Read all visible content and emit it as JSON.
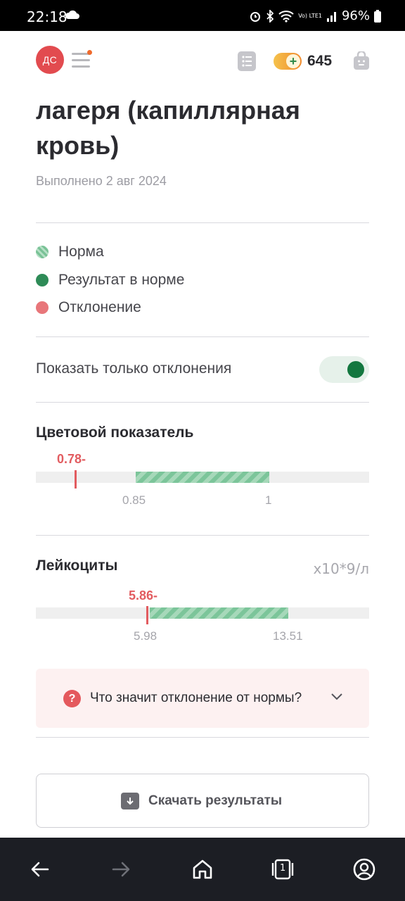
{
  "status_bar": {
    "time": "22:18",
    "battery": "96%",
    "network": "Vo) LTE1"
  },
  "header": {
    "avatar_initials": "ДС",
    "coins": "645",
    "accent": "#e24b4f"
  },
  "title": "лагеря (капиллярная кровь)",
  "date": "Выполнено 2 авг 2024",
  "legend": [
    {
      "label": "Норма",
      "color": "#7fc79c"
    },
    {
      "label": "Результат в норме",
      "color": "#2e8b57"
    },
    {
      "label": "Отклонение",
      "color": "#e8767a"
    }
  ],
  "toggle": {
    "label": "Показать только отклонения",
    "on": true
  },
  "indicators": [
    {
      "name": "Цветовой показатель",
      "unit": "",
      "value": 0.78,
      "value_label": "0.78-",
      "norm_min": 0.85,
      "norm_max": 1,
      "norm_min_label": "0.85",
      "norm_max_label": "1",
      "status": "below"
    },
    {
      "name": "Лейкоциты",
      "unit": "x10*9/л",
      "value": 5.86,
      "value_label": "5.86-",
      "norm_min": 5.98,
      "norm_max": 13.51,
      "norm_min_label": "5.98",
      "norm_max_label": "13.51",
      "status": "below"
    }
  ],
  "info": {
    "question": "Что значит отклонение от нормы?"
  },
  "download": {
    "label": "Скачать результаты"
  },
  "icons": {
    "status": [
      "cloud-icon",
      "alarm-icon",
      "bluetooth-icon",
      "wifi-icon",
      "signal-icon",
      "battery-icon"
    ],
    "nav": [
      "back-icon",
      "forward-icon",
      "home-icon",
      "tabs-icon",
      "profile-icon"
    ],
    "tabs_count": "1"
  }
}
